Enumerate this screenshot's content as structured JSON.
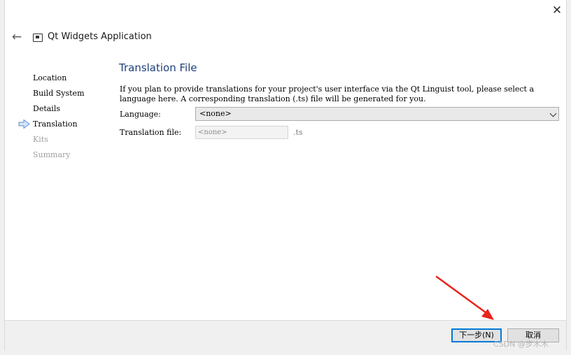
{
  "window": {
    "close_glyph": "✕",
    "back_glyph": "←",
    "title": "Qt Widgets Application"
  },
  "steps": [
    {
      "label": "Location",
      "state": "done"
    },
    {
      "label": "Build System",
      "state": "done"
    },
    {
      "label": "Details",
      "state": "done"
    },
    {
      "label": "Translation",
      "state": "current"
    },
    {
      "label": "Kits",
      "state": "pending"
    },
    {
      "label": "Summary",
      "state": "pending"
    }
  ],
  "page": {
    "title": "Translation File",
    "description": "If you plan to provide translations for your project's user interface via the Qt Linguist tool, please select a language here. A corresponding translation (.ts) file will be generated for you.",
    "language_label": "Language:",
    "language_value": "<none>",
    "file_label": "Translation file:",
    "file_placeholder": "<none>",
    "file_suffix": ".ts"
  },
  "footer": {
    "next_label": "下一步(N)",
    "cancel_label": "取消"
  },
  "watermark": "CSDN @步木木",
  "icons": {
    "close": "close-icon",
    "back": "back-arrow-icon",
    "wizard": "wizard-window-icon",
    "current_step": "current-step-arrow-icon",
    "dropdown": "chevron-down-icon"
  },
  "colors": {
    "title_blue": "#1e3f7a",
    "focus_blue": "#0078d7",
    "annotation_red": "#e8241c"
  }
}
